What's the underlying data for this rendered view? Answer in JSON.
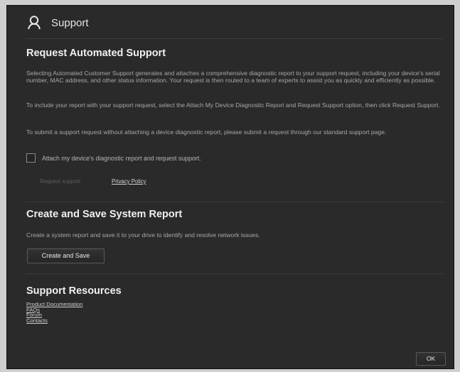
{
  "header": {
    "title": "Support",
    "icon": "person-icon"
  },
  "request": {
    "heading": "Request Automated Support",
    "para1": "Selecting Automated Customer Support generates and attaches a comprehensive diagnostic report to your support request, including your device's serial number, MAC address, and other status information. Your request is then routed to a team of experts to assist you as quickly and efficiently as possible.",
    "para2": "To include your report with your support request, select the Attach My Device Diagnostic Report and Request Support option, then click Request Support.",
    "para3": "To submit a support request without attaching a device diagnostic report, please submit a request through our standard support page.",
    "checkbox_label": "Attach my device's diagnostic report and request support.",
    "request_button": "Request support",
    "privacy_link": "Privacy Policy"
  },
  "system_report": {
    "heading": "Create and Save System Report",
    "text": "Create a system report and save it to your drive to identify and resolve network issues.",
    "button": "Create and Save"
  },
  "resources": {
    "heading": "Support Resources",
    "links": [
      "Product Documentation",
      "FAQs",
      "Forum",
      "Contacts"
    ]
  },
  "footer": {
    "ok_label": "OK"
  }
}
